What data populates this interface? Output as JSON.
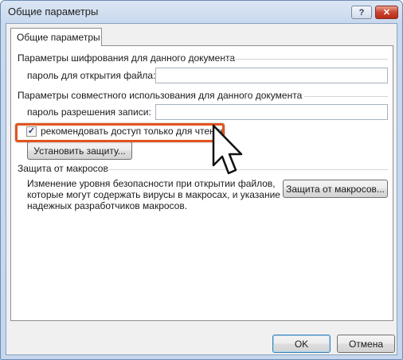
{
  "window": {
    "title": "Общие параметры",
    "help_glyph": "?",
    "close_glyph": "✕"
  },
  "tab": {
    "label": "Общие параметры"
  },
  "encryption": {
    "group_title": "Параметры шифрования для данного документа",
    "open_password_label": "пароль для открытия файла:",
    "open_password_value": ""
  },
  "sharing": {
    "group_title": "Параметры совместного использования для данного документа",
    "modify_password_label": "пароль разрешения записи:",
    "modify_password_value": "",
    "readonly_checkbox_label": "рекомендовать доступ только для чтения",
    "readonly_checked": true,
    "protect_button_label": "Установить защиту..."
  },
  "macro": {
    "group_title": "Защита от макросов",
    "description_lines": [
      "Изменение уровня безопасности при открытии файлов,",
      "которые могут содержать вирусы в макросах, и указание",
      "надежных разработчиков макросов."
    ],
    "button_label": "Защита от макросов..."
  },
  "footer": {
    "ok_label": "OK",
    "cancel_label": "Отмена"
  },
  "colors": {
    "highlight": "#e2541e",
    "title_bar": "#c9d9ee"
  }
}
